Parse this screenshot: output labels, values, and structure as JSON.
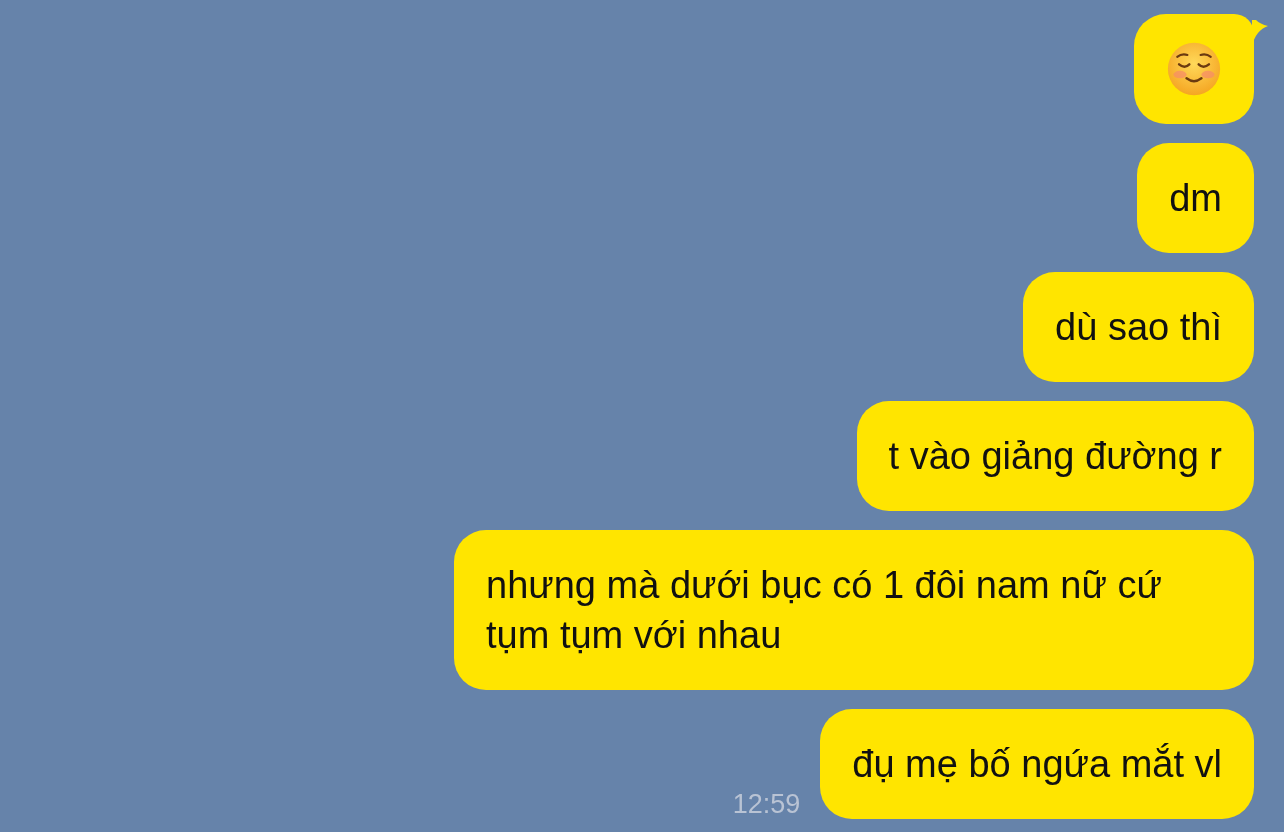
{
  "messages": [
    {
      "kind": "emoji",
      "tail": true
    },
    {
      "kind": "text",
      "text": "dm",
      "tail": false
    },
    {
      "kind": "text",
      "text": "dù sao thì",
      "tail": false
    },
    {
      "kind": "text",
      "text": "t vào giảng đường r",
      "tail": false
    },
    {
      "kind": "text",
      "text": "nhưng mà dưới bục có 1 đôi nam nữ cứ tụm tụm với nhau",
      "tail": false
    },
    {
      "kind": "text",
      "text": "đụ mẹ bố ngứa mắt vl",
      "tail": false
    }
  ],
  "timestamp": "12:59"
}
